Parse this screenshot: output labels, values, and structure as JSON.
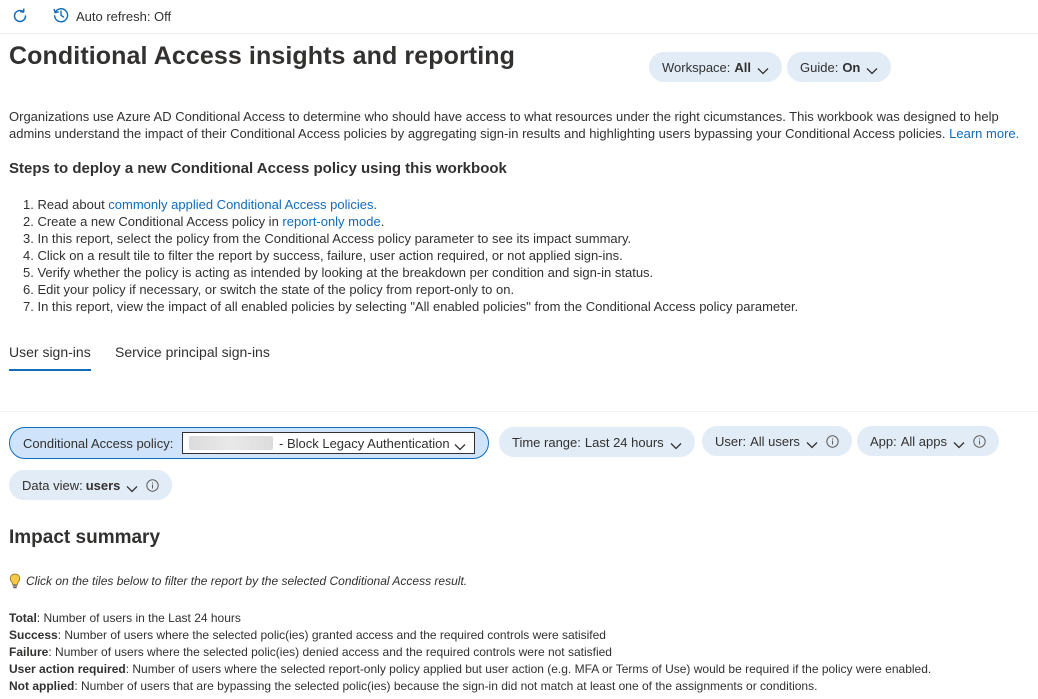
{
  "toolbar": {
    "refresh_icon": "refresh-icon",
    "auto_refresh_icon": "clock-history-icon",
    "auto_refresh_label": "Auto refresh: Off"
  },
  "header": {
    "title": "Conditional Access insights and reporting",
    "workspace": {
      "label": "Workspace:",
      "value": "All"
    },
    "guide": {
      "label": "Guide:",
      "value": "On"
    }
  },
  "intro": {
    "text": "Organizations use Azure AD Conditional Access to determine who should have access to what resources under the right cicumstances. This workbook was designed to help admins understand the impact of their Conditional Access policies by aggregating sign-in results and highlighting users bypassing your Conditional Access policies.",
    "link": "Learn more."
  },
  "steps": {
    "title": "Steps to deploy a new Conditional Access policy using this workbook",
    "s1_pre": "1. Read about ",
    "s1_link": "commonly applied Conditional Access policies.",
    "s2_pre": "2. Create a new Conditional Access policy in ",
    "s2_link": "report-only mode",
    "s2_post": ".",
    "s3": "3. In this report, select the policy from the Conditional Access policy parameter to see its impact summary.",
    "s4": "4. Click on a result tile to filter the report by success, failure, user action required, or not applied sign-ins.",
    "s5": "5. Verify whether the policy is acting as intended by looking at the breakdown per condition and sign-in status.",
    "s6": "6. Edit your policy if necessary, or switch the state of the policy from report-only to on.",
    "s7": "7. In this report, view the impact of all enabled policies by selecting \"All enabled policies\" from the Conditional Access policy parameter."
  },
  "tabs": [
    {
      "label": "User sign-ins",
      "active": true
    },
    {
      "label": "Service principal sign-ins",
      "active": false
    }
  ],
  "params": {
    "policy": {
      "label": "Conditional Access policy:",
      "value": "- Block Legacy Authentication"
    },
    "time_range": {
      "label": "Time range:",
      "value": "Last 24 hours"
    },
    "user": {
      "label": "User:",
      "value": "All users"
    },
    "app": {
      "label": "App:",
      "value": "All apps"
    },
    "data_view": {
      "label": "Data view:",
      "value": "users"
    }
  },
  "impact": {
    "title": "Impact summary",
    "hint": "Click on the tiles below to filter the report by the selected Conditional Access result.",
    "defs": [
      {
        "term": "Total",
        "desc": ": Number of users in the Last 24 hours"
      },
      {
        "term": "Success",
        "desc": ": Number of users where the selected polic(ies) granted access and the required controls were satisifed"
      },
      {
        "term": "Failure",
        "desc": ": Number of users where the selected polic(ies) denied access and the required controls were not satisfied"
      },
      {
        "term": "User action required",
        "desc": ": Number of users where the selected report-only policy applied but user action (e.g. MFA or Terms of Use) would be required if the policy were enabled."
      },
      {
        "term": "Not applied",
        "desc": ": Number of users that are bypassing the selected polic(ies) because the sign-in did not match at least one of the assignments or conditions."
      }
    ]
  },
  "colors": {
    "accent": "#0f6cbd",
    "pill_bg": "#e1ecf7",
    "selected_pill_bg": "#cfe4fa",
    "text": "#323130",
    "bulb": "#f7c948"
  }
}
